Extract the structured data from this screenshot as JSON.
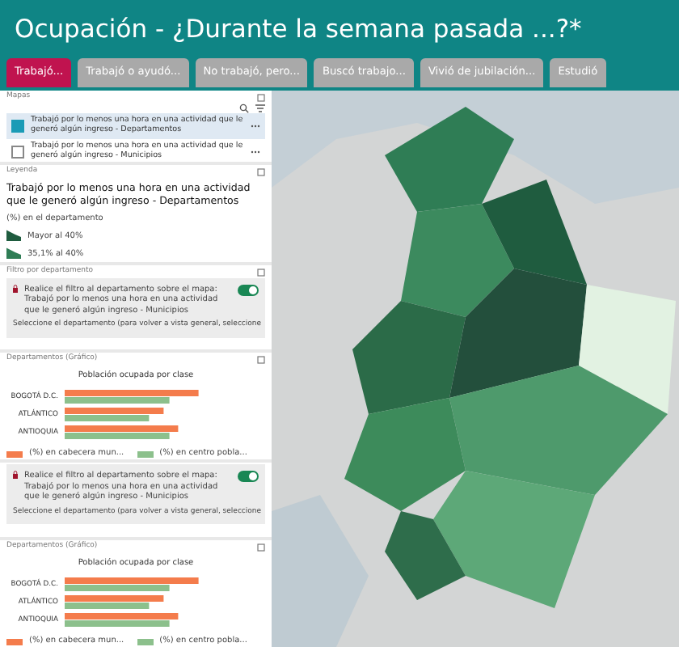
{
  "title": "Ocupación - ¿Durante la semana pasada ...?*",
  "tabs": [
    {
      "label": "Trabajó...",
      "selected": true
    },
    {
      "label": "Trabajó o ayudó...",
      "selected": false
    },
    {
      "label": "No trabajó, pero...",
      "selected": false
    },
    {
      "label": "Buscó trabajo...",
      "selected": false
    },
    {
      "label": "Vivió de jubilación...",
      "selected": false
    },
    {
      "label": "Estudió",
      "selected": false
    }
  ],
  "layers_panel": {
    "title": "Mapas",
    "layers": [
      {
        "label": "Trabajó por lo menos una hora en una actividad que le generó algún ingreso - Departamentos",
        "checked": true
      },
      {
        "label": "Trabajó por lo menos una hora en una actividad que le generó algún ingreso - Municipios",
        "checked": false
      }
    ]
  },
  "legend_panel": {
    "title": "Leyenda",
    "layer_title": "Trabajó por lo menos una hora en una actividad que le generó algún ingreso - Departamentos",
    "subtitle": "(%) en el departamento",
    "classes": [
      {
        "label": "Mayor al 40%",
        "color": "#1f5c3f"
      },
      {
        "label": "35,1% al 40%",
        "color": "#2f7d55"
      }
    ]
  },
  "sections": [
    {
      "kind": "filter",
      "title": "Filtro por departamento",
      "text": "Realice el filtro al departamento sobre el mapa: Trabajó por lo menos una hora en una actividad que le generó algún ingreso - Municipios",
      "on": true,
      "note": "Seleccione el departamento (para volver a vista general, seleccione"
    },
    {
      "kind": "chart",
      "title": "Departamentos (Gráfico)",
      "chart_title": "Población ocupada por clase",
      "categories": [
        "BOGOTÁ D.C.",
        "ATLÁNTICO",
        "ANTIOQUIA"
      ],
      "legend": [
        {
          "label": "(%) en cabecera mun...",
          "color": "#f47c4c"
        },
        {
          "label": "(%) en centro pobla...",
          "color": "#8cc08c"
        }
      ]
    },
    {
      "kind": "filter",
      "text": "Realice el filtro al departamento sobre el mapa: Trabajó por lo menos una hora en una actividad que le generó algún ingreso - Municipios",
      "on": true,
      "note": "Seleccione el departamento (para volver a vista general, seleccione"
    },
    {
      "kind": "chart",
      "title": "Departamentos (Gráfico)",
      "chart_title": "Población ocupada por clase",
      "categories": [
        "BOGOTÁ D.C.",
        "ATLÁNTICO",
        "ANTIOQUIA"
      ],
      "legend": [
        {
          "label": "(%) en cabecera mun...",
          "color": "#f47c4c"
        },
        {
          "label": "(%) en centro pobla...",
          "color": "#8cc08c"
        }
      ]
    }
  ]
}
